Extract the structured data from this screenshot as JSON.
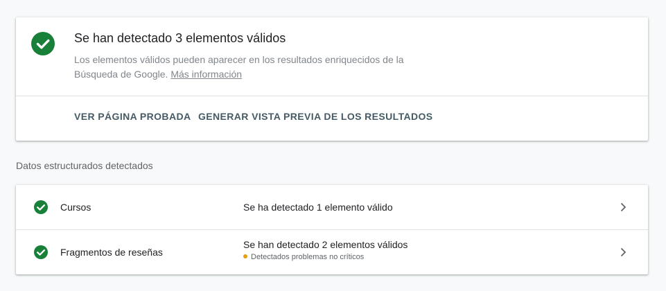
{
  "summary": {
    "title": "Se han detectado 3 elementos válidos",
    "description": "Los elementos válidos pueden aparecer en los resultados enriquecidos de la Búsqueda de Google.",
    "link": "Más información",
    "icon": "check-circle-icon",
    "actions": {
      "view_page": "VER PÁGINA PROBADA",
      "preview": "GENERAR VISTA PREVIA DE LOS RESULTADOS"
    }
  },
  "structured_data": {
    "section_title": "Datos estructurados detectados",
    "items": [
      {
        "name": "Cursos",
        "status": "Se ha detectado 1 elemento válido",
        "icon": "check-circle-icon"
      },
      {
        "name": "Fragmentos de reseñas",
        "status": "Se han detectado 2 elementos válidos",
        "warning": "Detectados problemas no críticos",
        "icon": "check-circle-icon"
      }
    ]
  },
  "colors": {
    "valid_green": "#188038",
    "warning_amber": "#e8a010",
    "action_text": "#455a64"
  }
}
